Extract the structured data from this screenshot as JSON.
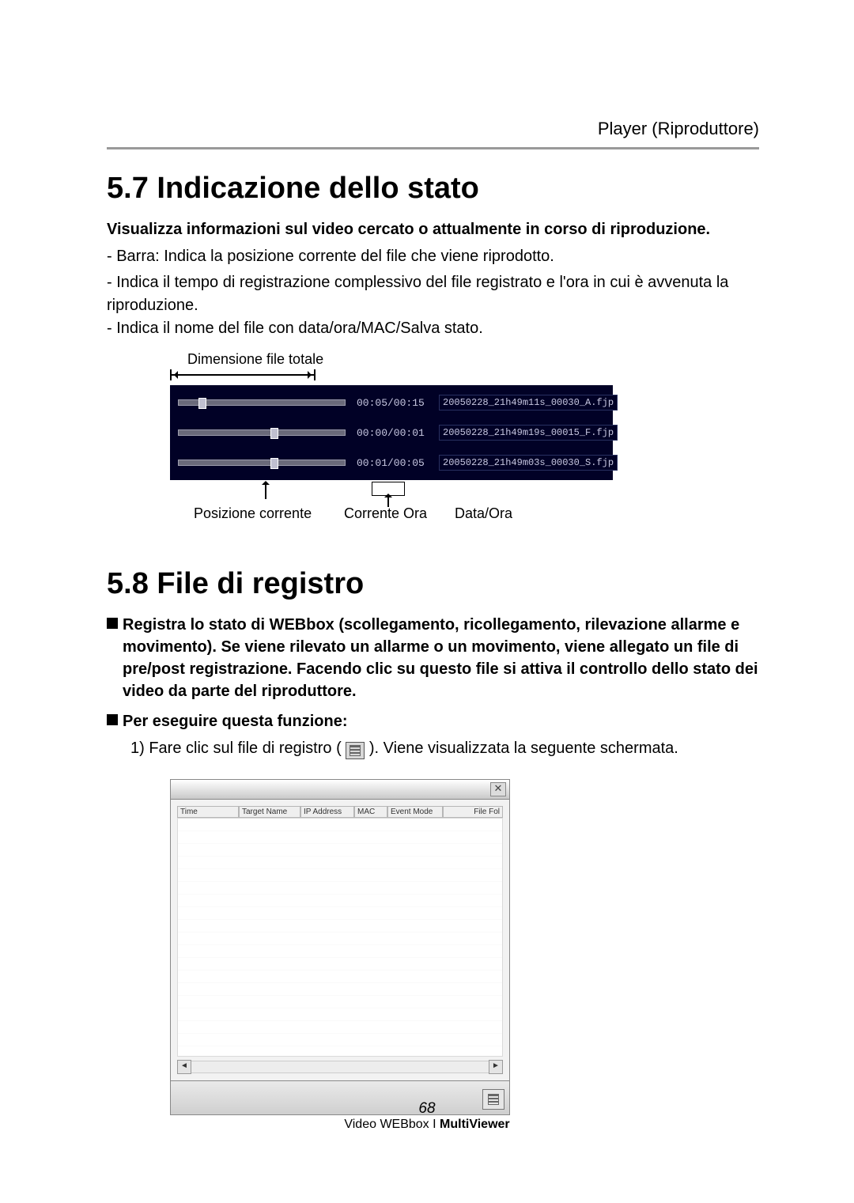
{
  "header": {
    "section_title": "Player (Riproduttore)"
  },
  "s57": {
    "heading": "5.7 Indicazione dello stato",
    "intro_bold": "Visualizza informazioni sul video cercato o attualmente in corso di riproduzione.",
    "b1": "- Barra: Indica la posizione corrente del file che viene riprodotto.",
    "b2": "- Indica il tempo di registrazione complessivo del file registrato e l'ora in cui è avvenuta la riproduzione.",
    "b3": "- Indica il nome del file con data/ora/MAC/Salva stato.",
    "dim_label": "Dimensione file totale",
    "rows": [
      {
        "time": "00:05/00:15",
        "file": "20050228_21h49m11s_00030_A.fjp",
        "thumb_pct": 12
      },
      {
        "time": "00:00/00:01",
        "file": "20050228_21h49m19s_00015_F.fjp",
        "thumb_pct": 55
      },
      {
        "time": "00:01/00:05",
        "file": "20050228_21h49m03s_00030_S.fjp",
        "thumb_pct": 55
      }
    ],
    "cap_pos": "Posizione corrente",
    "cap_time": "Corrente Ora",
    "cap_date": "Data/Ora"
  },
  "s58": {
    "heading": "5.8 File di registro",
    "para_bold": "Registra lo stato di WEBbox (scollegamento, ricollegamento, rilevazione allarme e movimento). Se viene rilevato un allarme o un movimento, viene allegato un file di pre/post registrazione. Facendo clic su questo file si attiva il controllo dello stato dei video da parte del riproduttore.",
    "subhead": "Per eseguire questa funzione:",
    "step_pre": "1) Fare clic sul file di registro (",
    "step_post": "). Viene visualizzata la seguente schermata.",
    "log_window": {
      "close": "✕",
      "columns": [
        "Time",
        "Target Name",
        "IP Address",
        "MAC",
        "Event Mode",
        "File Fol"
      ],
      "scroll_left": "◄",
      "scroll_right": "►"
    }
  },
  "footer": {
    "page_no": "68",
    "line": "Video WEBbox I ",
    "strong": "MultiViewer"
  }
}
